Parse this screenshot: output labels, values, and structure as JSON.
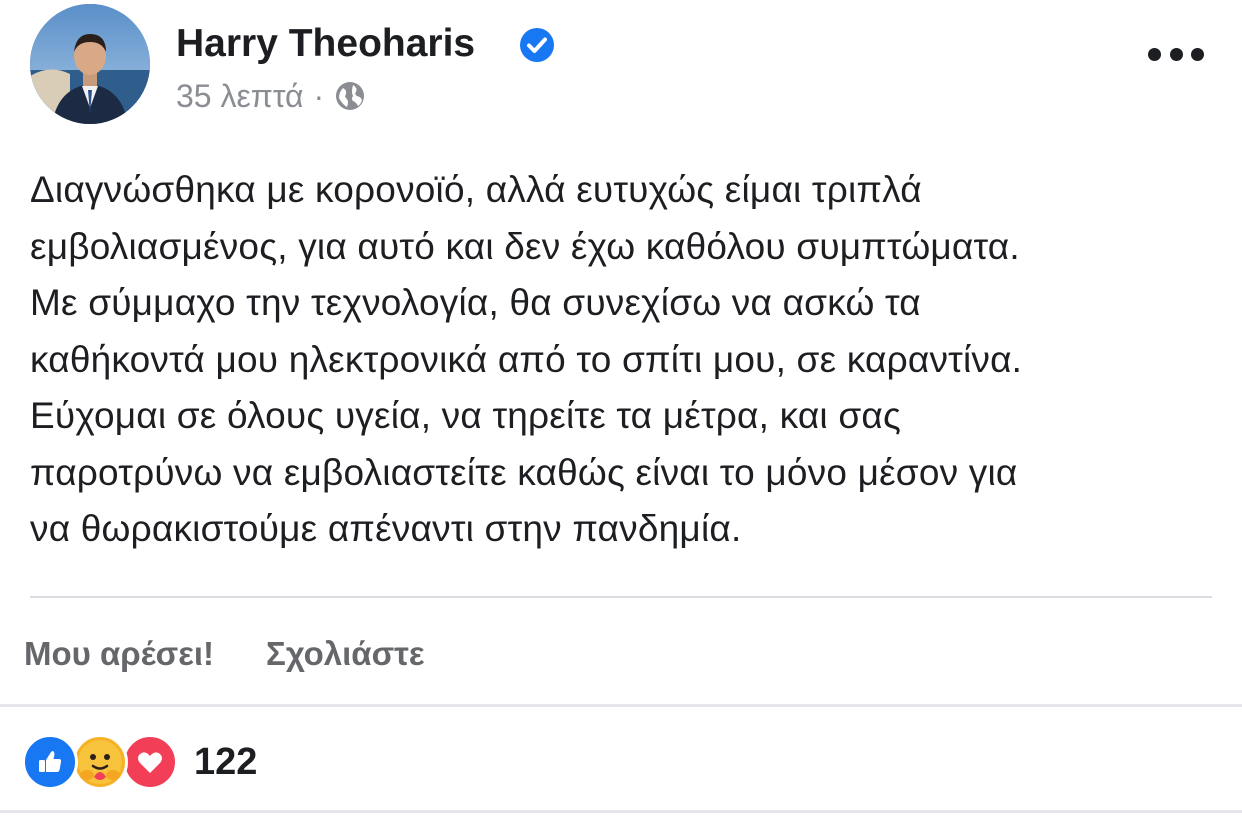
{
  "post": {
    "author": {
      "name": "Harry Theoharis",
      "verified": true
    },
    "timestamp": "35 λεπτά",
    "meta_separator": "·",
    "audience_icon": "globe-icon",
    "text_lines": [
      "Διαγνώσθηκα με κορονοϊό, αλλά ευτυχώς είμαι τριπλά",
      "εμβολιασμένος, για αυτό και δεν έχω καθόλου συμπτώματα.",
      "Με σύμμαχο την τεχνολογία, θα συνεχίσω να ασκώ τα",
      "καθήκοντά μου ηλεκτρονικά από το σπίτι μου, σε καραντίνα.",
      "Εύχομαι σε όλους υγεία, να τηρείτε τα μέτρα, και σας",
      "παροτρύνω να εμβολιαστείτε καθώς είναι το μόνο μέσον για",
      "να θωρακιστούμε απέναντι στην πανδημία."
    ]
  },
  "actions": {
    "like_label": "Μου αρέσει!",
    "comment_label": "Σχολιάστε"
  },
  "reactions": {
    "types": [
      "like-icon",
      "care-icon",
      "love-icon"
    ],
    "count": "122"
  },
  "colors": {
    "verified": "#1877f2",
    "like": "#1877f2",
    "care": "#f7b125",
    "love": "#f33e58",
    "secondary_text": "#8a8d91"
  }
}
